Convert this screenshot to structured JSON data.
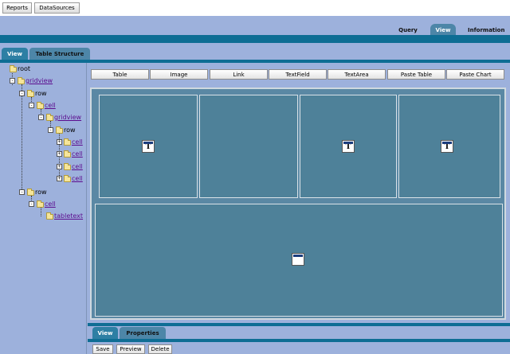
{
  "toolbar": {
    "reports": "Reports",
    "datasources": "DataSources"
  },
  "top_tabs": {
    "query": "Query",
    "view": "View",
    "information": "Information"
  },
  "left_tabs": {
    "view": "View",
    "table_structure": "Table Structure"
  },
  "tree": {
    "root": "root",
    "gridview": "gridview",
    "row1": "row",
    "cell1": "cell",
    "gridview2": "gridview",
    "row2": "row",
    "cell_a": "cell",
    "cell_b": "cell",
    "cell_c": "cell",
    "cell_d": "cell",
    "row3": "row",
    "cell3": "cell",
    "tabletext": "tabletext"
  },
  "controls": [
    "Table",
    "Image",
    "Link",
    "TextField",
    "TextArea",
    "Paste Table",
    "Paste Chart"
  ],
  "bottom_tabs": {
    "view": "View",
    "properties": "Properties"
  },
  "actions": {
    "save": "Save",
    "preview": "Preview",
    "delete": "Delete"
  },
  "icons": {
    "text_icon_glyph": "T"
  },
  "colors": {
    "accent": "#0e6d94",
    "background": "#9db1dc",
    "canvas": "#5a88a4",
    "link": "#5c0c8e"
  }
}
